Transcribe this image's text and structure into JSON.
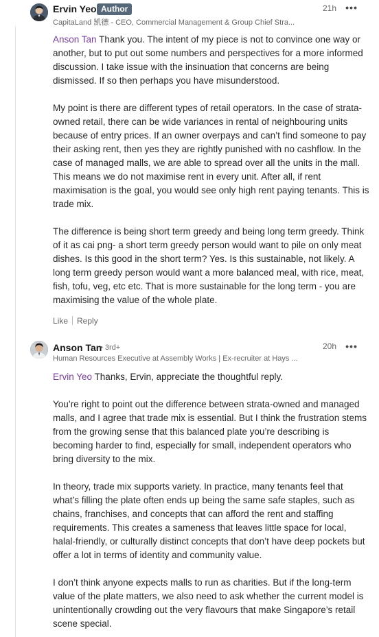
{
  "comments": [
    {
      "author": "Ervin Yeo",
      "badge": "Author",
      "headline": "CapitaLand 凯德 - CEO, Commercial Management & Group Chief Stra...",
      "time": "21h",
      "more_label": "•••",
      "mention": "Anson Tan",
      "p1_rest": " Thank you. The intent of my piece is not to convince one way or another, but to put out some numbers and perspectives for a more informed discussion. I take issue with the insinuation that concerns are being dismissed. If so then perhaps you have misunderstood.",
      "p2": "My point is there are different types of retail operators. In the case of strata-owned retail, there can be wide variances in rental of neighbouring units because of entry prices. If an owner overpays and can’t find someone to pay their asking rent, then yes they are rightly punished with no cashflow. In the case of managed malls, we are able to spread over all the units in the mall. This means we do not maximise rent in every unit. After all, if rent maximisation is the goal, you would see only high rent paying tenants. This is trade mix.",
      "p3": "The difference is being short term greedy and being long term greedy. Think of it as cai png- a short term greedy person would want to pile on only meat dishes. Is this good in the short term? Yes. Is this sustainable, not likely. A long term greedy person would want a more balanced meal, with rice, meat, fish, tofu, veg, etc etc. That is more sustainable for the long term - you are maximising the value of the whole plate.",
      "like_label": "Like",
      "reply_label": "Reply"
    },
    {
      "author": "Anson Tan",
      "degree": "• 3rd+",
      "headline": "Human Resources Executive at Assembly Works | Ex-recruiter at Hays ...",
      "time": "20h",
      "more_label": "•••",
      "mention": "Ervin Yeo",
      "p1_rest": " Thanks, Ervin, appreciate the thoughtful reply.",
      "p2": "You’re right to point out the difference between strata-owned and managed malls, and I agree that trade mix is essential. But I think the frustration stems from the growing sense that this balanced plate you’re describing is becoming harder to find, especially for small, independent operators who bring diversity to the mix.",
      "p3": "In theory, trade mix supports variety. In practice, many tenants feel that what’s filling the plate often ends up being the same safe staples, such as chains, franchises, and concepts that can afford the rent and staffing requirements. This creates a sameness that leaves little space for local, halal-friendly, or culturally distinct concepts that don’t have deep pockets but offer a lot in terms of identity and community value.",
      "p4": "I don’t think anyone expects malls to run as charities. But if the long-term value of the plate matters, we also need to ask whether the current model is unintentionally crowding out the very flavours that make Singapore’s retail scene special."
    }
  ],
  "colors": {
    "mention": "#7a3fa0",
    "badge_bg": "#56687a",
    "text": "#262626",
    "muted": "#666666",
    "thread_line": "#e3e3e3"
  },
  "icons": {
    "more": "ellipsis-icon",
    "avatar": "profile-photo"
  }
}
